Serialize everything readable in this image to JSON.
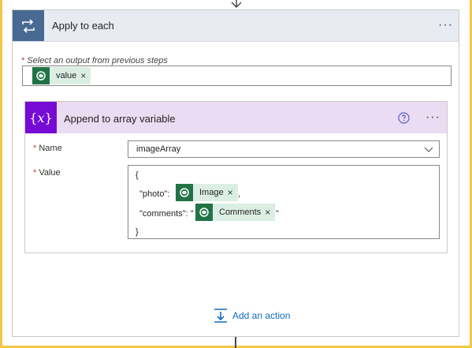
{
  "apply_to_each": {
    "title": "Apply to each",
    "output_label": "Select an output from previous steps",
    "output_token": {
      "label": "value",
      "remove": "×"
    }
  },
  "append_action": {
    "title": "Append to array variable",
    "name_label": "Name",
    "name_value": "imageArray",
    "value_label": "Value",
    "value_lines": {
      "open_brace": "{",
      "photo_key": "\"photo\":",
      "photo_comma": ",",
      "comments_key": "\"comments\": \"",
      "comments_close": "\"",
      "close_brace": "}"
    },
    "photo_token": {
      "label": "Image",
      "remove": "×"
    },
    "comments_token": {
      "label": "Comments",
      "remove": "×"
    }
  },
  "required_marker": "*",
  "more_menu": "···",
  "add_action_label": "Add an action",
  "icons": {
    "loop": "loop-icon",
    "variable": "variable-icon",
    "dataverse": "dataverse-icon",
    "help": "help-icon",
    "chevron": "chevron-down-icon",
    "add_action": "add-action-icon"
  },
  "colors": {
    "loop_accent": "#486991",
    "variable_accent": "#770bd6",
    "token_bg": "#dbeee4",
    "token_icon": "#217346",
    "link": "#0f6cbd",
    "frame": "#f2c744"
  }
}
